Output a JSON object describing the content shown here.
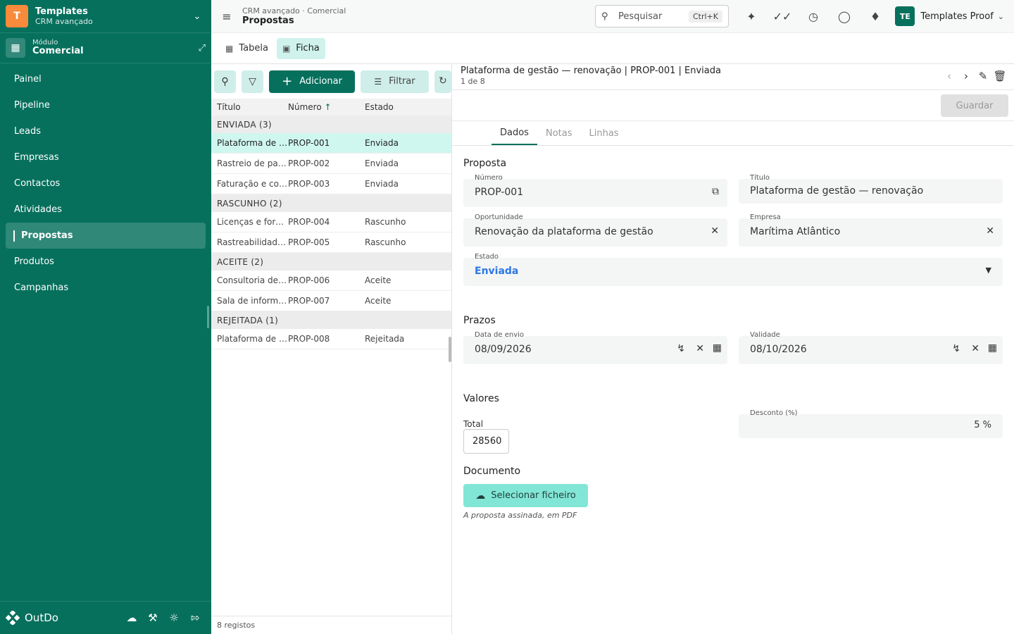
{
  "app": {
    "logo_letter": "T",
    "title": "Templates",
    "subtitle": "CRM avançado",
    "module_label": "Módulo",
    "module_name": "Comercial",
    "brand_name": "OutDo"
  },
  "sidebar": {
    "items": [
      {
        "label": "Painel"
      },
      {
        "label": "Pipeline"
      },
      {
        "label": "Leads"
      },
      {
        "label": "Empresas"
      },
      {
        "label": "Contactos"
      },
      {
        "label": "Atividades"
      },
      {
        "label": "Propostas"
      },
      {
        "label": "Produtos"
      },
      {
        "label": "Campanhas"
      }
    ]
  },
  "topbar": {
    "breadcrumb_path": "CRM avançado · Comercial",
    "breadcrumb_page": "Propostas",
    "search_placeholder": "Pesquisar",
    "search_shortcut": "Ctrl+K",
    "user_initials": "TE",
    "user_name": "Templates Proof"
  },
  "view_tabs": [
    {
      "label": "Tabela"
    },
    {
      "label": "Ficha"
    }
  ],
  "list": {
    "add_label": "Adicionar",
    "filter_label": "Filtrar",
    "columns": [
      "Título",
      "Número",
      "Estado"
    ],
    "sort_indicator": "↑",
    "groups": [
      {
        "label": "ENVIADA (3)",
        "rows": [
          {
            "titulo": "Plataforma de gestão — renovação",
            "numero": "PROP-001",
            "estado": "Enviada"
          },
          {
            "titulo": "Rastreio de paletes",
            "numero": "PROP-002",
            "estado": "Enviada"
          },
          {
            "titulo": "Faturação e cobrança",
            "numero": "PROP-003",
            "estado": "Enviada"
          }
        ]
      },
      {
        "label": "RASCUNHO (2)",
        "rows": [
          {
            "titulo": "Licenças e formação",
            "numero": "PROP-004",
            "estado": "Rascunho"
          },
          {
            "titulo": "Rastreabilidade de lotes",
            "numero": "PROP-005",
            "estado": "Rascunho"
          }
        ]
      },
      {
        "label": "ACEITE (2)",
        "rows": [
          {
            "titulo": "Consultoria de dados",
            "numero": "PROP-006",
            "estado": "Aceite"
          },
          {
            "titulo": "Sala de informática",
            "numero": "PROP-007",
            "estado": "Aceite"
          }
        ]
      },
      {
        "label": "REJEITADA (1)",
        "rows": [
          {
            "titulo": "Plataforma de cursos",
            "numero": "PROP-008",
            "estado": "Rejeitada"
          }
        ]
      }
    ],
    "footer": "8 registos"
  },
  "detail": {
    "title": "Plataforma de gestão — renovação | PROP-001 | Enviada",
    "count": "1 de 8",
    "save_label": "Guardar",
    "tabs": [
      {
        "label": "Dados"
      },
      {
        "label": "Notas"
      },
      {
        "label": "Linhas"
      }
    ],
    "section_proposta": "Proposta",
    "numero_label": "Número",
    "numero_value": "PROP-001",
    "titulo_label": "Título",
    "titulo_value": "Plataforma de gestão — renovação",
    "oportunidade_label": "Oportunidade",
    "oportunidade_value": "Renovação da plataforma de gestão",
    "empresa_label": "Empresa",
    "empresa_value": "Marítima Atlântico",
    "estado_label": "Estado",
    "estado_value": "Enviada",
    "section_prazos": "Prazos",
    "envio_label": "Data de envio",
    "envio_value": "08/09/2026",
    "validade_label": "Validade",
    "validade_value": "08/10/2026",
    "section_valores": "Valores",
    "total_label": "Total",
    "total_value": "28560",
    "desconto_label": "Desconto (%)",
    "desconto_value": "5 %",
    "section_documento": "Documento",
    "upload_label": "Selecionar ficheiro",
    "upload_hint": "A proposta assinada, em PDF"
  },
  "colors": {
    "primary": "#06705d",
    "accent_light": "#cff2ec",
    "estado_link": "#2a78e4",
    "logo_orange": "#f78a3b"
  }
}
